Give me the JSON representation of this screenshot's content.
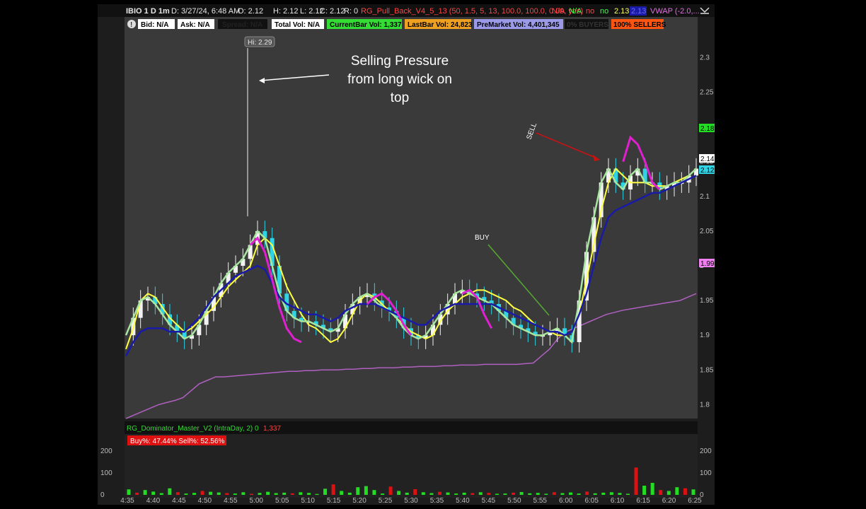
{
  "header": {
    "symbol": "IBIO 1 D 1m",
    "datetime": "D: 3/27/24, 6:48 AM",
    "open": "O: 2.12",
    "high": "H: 2.12",
    "low": "L: 2.12",
    "close": "C: 2.12",
    "range": "R: 0",
    "study": "RG_Pull_Back_V4_5_13 (50, 1.5, 5, 13, 100.0, 100.0, 0.09, yes)",
    "s1": "N/A",
    "s2": "N/A",
    "s3": "no",
    "s4": "no",
    "s5": "2.13",
    "s6": "2.13",
    "vwap": "VWAP (-2.0,..."
  },
  "labels_bar": {
    "alert": "!",
    "bid": "Bid: N/A",
    "ask": "Ask: N/A",
    "spread": "Spread: N/A",
    "total_vol": "Total Vol: N/A",
    "current_bar_vol": "CurrentBar Vol: 1,337",
    "last_bar_vol": "LastBar Vol: 24,823",
    "premarket_vol": "PreMarket Vol: 4,401,345",
    "buyers": "0% BUYERS",
    "sellers": "100% SELLERS"
  },
  "annotations": {
    "hi_label": "Hi: 2.29",
    "selling_pressure": [
      "Selling Pressure",
      "from long wick on",
      "top"
    ],
    "buy": "BUY",
    "sell": "SELL"
  },
  "price_badges": [
    "2.18",
    "2.14",
    "2.12",
    "1.99"
  ],
  "lower_panel": {
    "study": "RG_Dominator_Master_V2 (IntraDay, 2)",
    "v0": "0",
    "v1": "1,337",
    "buy_sell": "Buy%: 47.44%   Sell%: 52.56%"
  },
  "colors": {
    "up_candle": "#f2f2f2",
    "down_candle": "#2ed3e6",
    "ema_fast": "#ffff44",
    "ema_mid": "#a8e6a0",
    "trend": "#1a1aa8",
    "magenta": "#e020d0",
    "vwap": "#b060c0",
    "vol_up": "#22dd22",
    "vol_down": "#dd1111"
  },
  "chart_data": {
    "type": "line",
    "title": "IBIO 1 D 1m",
    "x_tick_labels": [
      "4:35",
      "4:40",
      "4:45",
      "4:50",
      "4:55",
      "5:00",
      "5:05",
      "5:10",
      "5:15",
      "5:20",
      "5:25",
      "5:30",
      "5:35",
      "5:40",
      "5:45",
      "5:50",
      "5:55",
      "6:00",
      "6:05",
      "6:10",
      "6:15",
      "6:20",
      "6:25"
    ],
    "y_tick_labels": [
      "2.3",
      "2.25",
      "2.2",
      "2.15",
      "2.1",
      "2.05",
      "2",
      "1.95",
      "1.9",
      "1.85",
      "1.8"
    ],
    "ylim": [
      1.78,
      2.33
    ],
    "vol_ticks": [
      "200",
      "100",
      "0"
    ],
    "vol_ylim": [
      0,
      220
    ],
    "series": [
      {
        "type": "line",
        "values": [
          1.88,
          1.91,
          1.95,
          1.96,
          1.955,
          1.94,
          1.925,
          1.915,
          1.905,
          1.91,
          1.92,
          1.93,
          1.94,
          1.955,
          1.97,
          1.98,
          1.99,
          2.0,
          2.03,
          2.04,
          2.03,
          2.0,
          1.97,
          1.95,
          1.93,
          1.915,
          1.91,
          1.9,
          1.89,
          1.895,
          1.91,
          1.93,
          1.95,
          1.96,
          1.955,
          1.945,
          1.935,
          1.925,
          1.915,
          1.905,
          1.9,
          1.895,
          1.9,
          1.92,
          1.935,
          1.945,
          1.955,
          1.96,
          1.965,
          1.965,
          1.96,
          1.955,
          1.95,
          1.94,
          1.935,
          1.925,
          1.915,
          1.91,
          1.905,
          1.9,
          1.9,
          1.905,
          1.93,
          1.98,
          2.03,
          2.08,
          2.12,
          2.14,
          2.13,
          2.12,
          2.12,
          2.12,
          2.115,
          2.115,
          2.115,
          2.12,
          2.125,
          2.13,
          2.14
        ]
      },
      {
        "type": "line",
        "values": [
          1.9,
          1.925,
          1.95,
          1.955,
          1.945,
          1.93,
          1.915,
          1.905,
          1.895,
          1.9,
          1.915,
          1.935,
          1.955,
          1.975,
          1.99,
          2.0,
          2.01,
          2.03,
          2.05,
          2.04,
          2.0,
          1.96,
          1.935,
          1.925,
          1.92,
          1.92,
          1.915,
          1.91,
          1.905,
          1.91,
          1.93,
          1.945,
          1.955,
          1.96,
          1.95,
          1.94,
          1.935,
          1.925,
          1.91,
          1.9,
          1.895,
          1.9,
          1.915,
          1.93,
          1.945,
          1.96,
          1.965,
          1.96,
          1.955,
          1.95,
          1.945,
          1.935,
          1.925,
          1.915,
          1.91,
          1.905,
          1.9,
          1.9,
          1.905,
          1.91,
          1.9,
          1.89,
          1.95,
          2.02,
          2.07,
          2.12,
          2.14,
          2.12,
          2.11,
          2.13,
          2.14,
          2.12,
          2.12,
          2.11,
          2.115,
          2.12,
          2.12,
          2.13,
          2.14
        ]
      },
      {
        "type": "line",
        "values": [
          1.87,
          1.89,
          1.905,
          1.91,
          1.91,
          1.91,
          1.905,
          1.905,
          1.905,
          1.915,
          1.925,
          1.94,
          1.955,
          1.965,
          1.975,
          1.985,
          1.99,
          1.995,
          2.0,
          1.995,
          1.975,
          1.955,
          1.945,
          1.94,
          1.935,
          1.93,
          1.93,
          1.925,
          1.92,
          1.925,
          1.935,
          1.94,
          1.945,
          1.945,
          1.945,
          1.94,
          1.935,
          1.93,
          1.925,
          1.92,
          1.915,
          1.915,
          1.925,
          1.935,
          1.94,
          1.945,
          1.945,
          1.945,
          1.945,
          1.945,
          1.945,
          1.94,
          1.935,
          1.93,
          1.925,
          1.92,
          1.915,
          1.91,
          1.905,
          1.905,
          1.9,
          1.905,
          1.93,
          1.96,
          2.0,
          2.04,
          2.07,
          2.08,
          2.085,
          2.09,
          2.095,
          2.1,
          2.105,
          2.105,
          2.11,
          2.115,
          2.12,
          2.125,
          2.13
        ]
      },
      {
        "type": "line",
        "values": [
          null,
          null,
          null,
          null,
          null,
          null,
          null,
          null,
          null,
          null,
          null,
          null,
          null,
          null,
          null,
          null,
          null,
          2.03,
          2.04,
          2.02,
          1.98,
          1.94,
          1.91,
          1.895,
          1.89,
          null,
          null,
          null,
          null,
          null,
          null,
          null,
          null,
          1.945,
          1.955,
          1.96,
          1.95,
          1.935,
          1.915,
          1.9,
          null,
          null,
          null,
          null,
          null,
          null,
          1.96,
          1.965,
          1.955,
          1.93,
          1.91,
          null,
          null,
          null,
          null,
          null,
          null,
          null,
          null,
          null,
          null,
          null,
          null,
          null,
          null,
          null,
          null,
          null,
          2.15,
          2.185,
          2.175,
          2.15,
          2.12,
          2.11,
          null,
          null,
          null,
          null,
          null
        ]
      },
      {
        "type": "line",
        "values": [
          1.78,
          1.785,
          1.79,
          1.795,
          1.8,
          1.803,
          1.806,
          1.81,
          1.82,
          1.83,
          1.835,
          1.84,
          1.84,
          1.841,
          1.842,
          1.843,
          1.844,
          1.845,
          1.846,
          1.847,
          1.848,
          1.848,
          1.849,
          1.849,
          1.85,
          1.85,
          1.85,
          1.851,
          1.851,
          1.852,
          1.852,
          1.853,
          1.853,
          1.853,
          1.854,
          1.854,
          1.855,
          1.855,
          1.855,
          1.856,
          1.856,
          1.857,
          1.857,
          1.857,
          1.858,
          1.858,
          1.858,
          1.858,
          1.858,
          1.859,
          1.86,
          1.87,
          1.88,
          1.895,
          1.905,
          1.91,
          1.915,
          1.92,
          1.925,
          1.93,
          1.933,
          1.936,
          1.938,
          1.94,
          1.942,
          1.944,
          1.946,
          1.948,
          1.95,
          1.955,
          1.96
        ]
      }
    ],
    "volume": [
      {
        "v": 25,
        "c": "g"
      },
      {
        "v": 10,
        "c": "r"
      },
      {
        "v": 22,
        "c": "g"
      },
      {
        "v": 15,
        "c": "g"
      },
      {
        "v": 8,
        "c": "g"
      },
      {
        "v": 30,
        "c": "g"
      },
      {
        "v": 12,
        "c": "r"
      },
      {
        "v": 6,
        "c": "g"
      },
      {
        "v": 9,
        "c": "g"
      },
      {
        "v": 18,
        "c": "r"
      },
      {
        "v": 14,
        "c": "g"
      },
      {
        "v": 11,
        "c": "g"
      },
      {
        "v": 8,
        "c": "r"
      },
      {
        "v": 6,
        "c": "g"
      },
      {
        "v": 12,
        "c": "g"
      },
      {
        "v": 5,
        "c": "r"
      },
      {
        "v": 9,
        "c": "g"
      },
      {
        "v": 14,
        "c": "g"
      },
      {
        "v": 8,
        "c": "g"
      },
      {
        "v": 10,
        "c": "g"
      },
      {
        "v": 7,
        "c": "r"
      },
      {
        "v": 12,
        "c": "g"
      },
      {
        "v": 9,
        "c": "g"
      },
      {
        "v": 4,
        "c": "g"
      },
      {
        "v": 28,
        "c": "g"
      },
      {
        "v": 48,
        "c": "r"
      },
      {
        "v": 18,
        "c": "g"
      },
      {
        "v": 10,
        "c": "g"
      },
      {
        "v": 35,
        "c": "g"
      },
      {
        "v": 40,
        "c": "g"
      },
      {
        "v": 22,
        "c": "g"
      },
      {
        "v": 6,
        "c": "g"
      },
      {
        "v": 38,
        "c": "r"
      },
      {
        "v": 18,
        "c": "g"
      },
      {
        "v": 10,
        "c": "g"
      },
      {
        "v": 26,
        "c": "r"
      },
      {
        "v": 12,
        "c": "g"
      },
      {
        "v": 8,
        "c": "g"
      },
      {
        "v": 14,
        "c": "r"
      },
      {
        "v": 11,
        "c": "g"
      },
      {
        "v": 6,
        "c": "g"
      },
      {
        "v": 10,
        "c": "g"
      },
      {
        "v": 8,
        "c": "r"
      },
      {
        "v": 12,
        "c": "g"
      },
      {
        "v": 9,
        "c": "r"
      },
      {
        "v": 5,
        "c": "g"
      },
      {
        "v": 6,
        "c": "g"
      },
      {
        "v": 10,
        "c": "r"
      },
      {
        "v": 13,
        "c": "g"
      },
      {
        "v": 7,
        "c": "g"
      },
      {
        "v": 9,
        "c": "g"
      },
      {
        "v": 5,
        "c": "g"
      },
      {
        "v": 12,
        "c": "r"
      },
      {
        "v": 8,
        "c": "g"
      },
      {
        "v": 11,
        "c": "g"
      },
      {
        "v": 6,
        "c": "g"
      },
      {
        "v": 15,
        "c": "r"
      },
      {
        "v": 7,
        "c": "g"
      },
      {
        "v": 10,
        "c": "g"
      },
      {
        "v": 12,
        "c": "g"
      },
      {
        "v": 9,
        "c": "g"
      },
      {
        "v": 5,
        "c": "g"
      },
      {
        "v": 125,
        "c": "r"
      },
      {
        "v": 42,
        "c": "g"
      },
      {
        "v": 55,
        "c": "g"
      },
      {
        "v": 22,
        "c": "r"
      },
      {
        "v": 18,
        "c": "g"
      },
      {
        "v": 35,
        "c": "g"
      },
      {
        "v": 30,
        "c": "r"
      },
      {
        "v": 25,
        "c": "g"
      }
    ]
  }
}
